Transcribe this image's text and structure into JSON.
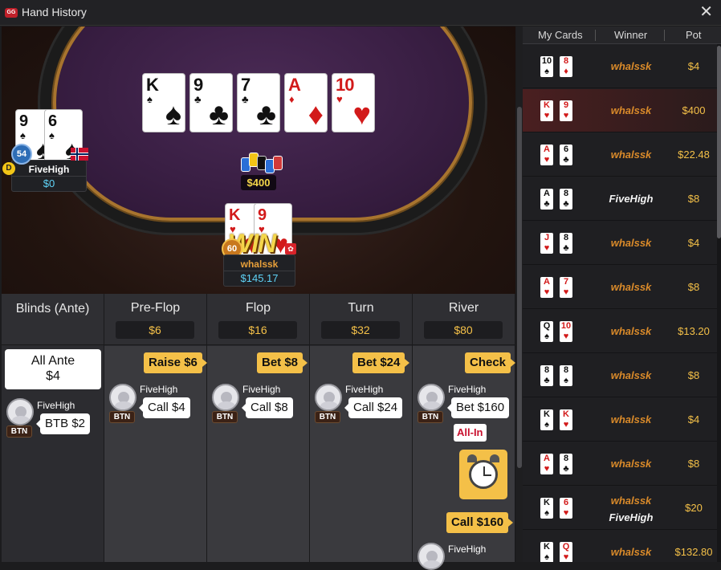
{
  "window": {
    "title": "Hand History",
    "logo": "GG",
    "close_icon": "close-icon"
  },
  "board": {
    "cards": [
      {
        "rank": "K",
        "suit": "♠",
        "red": false
      },
      {
        "rank": "9",
        "suit": "♣",
        "red": false
      },
      {
        "rank": "7",
        "suit": "♣",
        "red": false
      },
      {
        "rank": "A",
        "suit": "♦",
        "red": true
      },
      {
        "rank": "10",
        "suit": "♥",
        "red": true
      }
    ],
    "pot": "$400"
  },
  "seats": {
    "left": {
      "name": "FiveHigh",
      "stack": "$0",
      "level": "54",
      "dealer": "D",
      "cards": [
        {
          "rank": "9",
          "suit": "♠",
          "red": false
        },
        {
          "rank": "6",
          "suit": "♠",
          "red": false
        }
      ]
    },
    "bottom": {
      "name": "whalssk",
      "stack": "$145.17",
      "level": "60",
      "badge": "WIN",
      "cards": [
        {
          "rank": "K",
          "suit": "♥",
          "red": true
        },
        {
          "rank": "9",
          "suit": "♥",
          "red": true
        }
      ]
    }
  },
  "streets": [
    {
      "title": "Blinds (Ante)",
      "amount": ""
    },
    {
      "title": "Pre-Flop",
      "amount": "$6"
    },
    {
      "title": "Flop",
      "amount": "$16"
    },
    {
      "title": "Turn",
      "amount": "$32"
    },
    {
      "title": "River",
      "amount": "$80"
    }
  ],
  "actions": {
    "ante_line1": "All Ante",
    "ante_line2": "$4",
    "blinds_player": "FiveHigh",
    "blinds_action": "BTB $2",
    "btn": "BTN",
    "preflop_tag": "Raise $6",
    "preflop_player": "FiveHigh",
    "preflop_action": "Call $4",
    "flop_tag": "Bet $8",
    "flop_player": "FiveHigh",
    "flop_action": "Call $8",
    "turn_tag": "Bet $24",
    "turn_player": "FiveHigh",
    "turn_action": "Call $24",
    "river_tag": "Check",
    "river_player": "FiveHigh",
    "river_action": "Bet $160",
    "river_allin": "All-In",
    "river_call": "Call $160",
    "river_player2": "FiveHigh"
  },
  "history": {
    "headers": {
      "cards": "My Cards",
      "winner": "Winner",
      "pot": "Pot"
    },
    "rows": [
      {
        "c1": "10",
        "s1": "♠",
        "r1": false,
        "c2": "8",
        "s2": "♦",
        "r2": true,
        "winner": "whalssk",
        "pot": "$4"
      },
      {
        "c1": "K",
        "s1": "♥",
        "r1": true,
        "c2": "9",
        "s2": "♥",
        "r2": true,
        "winner": "whalssk",
        "pot": "$400"
      },
      {
        "c1": "A",
        "s1": "♥",
        "r1": true,
        "c2": "6",
        "s2": "♣",
        "r2": false,
        "winner": "whalssk",
        "pot": "$22.48"
      },
      {
        "c1": "A",
        "s1": "♣",
        "r1": false,
        "c2": "8",
        "s2": "♣",
        "r2": false,
        "winner": "FiveHigh",
        "pot": "$8"
      },
      {
        "c1": "J",
        "s1": "♥",
        "r1": true,
        "c2": "8",
        "s2": "♣",
        "r2": false,
        "winner": "whalssk",
        "pot": "$4"
      },
      {
        "c1": "A",
        "s1": "♥",
        "r1": true,
        "c2": "7",
        "s2": "♥",
        "r2": true,
        "winner": "whalssk",
        "pot": "$8"
      },
      {
        "c1": "Q",
        "s1": "♠",
        "r1": false,
        "c2": "10",
        "s2": "♥",
        "r2": true,
        "winner": "whalssk",
        "pot": "$13.20"
      },
      {
        "c1": "8",
        "s1": "♣",
        "r1": false,
        "c2": "8",
        "s2": "♠",
        "r2": false,
        "winner": "whalssk",
        "pot": "$8"
      },
      {
        "c1": "K",
        "s1": "♠",
        "r1": false,
        "c2": "K",
        "s2": "♥",
        "r2": true,
        "winner": "whalssk",
        "pot": "$4"
      },
      {
        "c1": "A",
        "s1": "♥",
        "r1": true,
        "c2": "8",
        "s2": "♣",
        "r2": false,
        "winner": "whalssk",
        "pot": "$8"
      },
      {
        "c1": "K",
        "s1": "♠",
        "r1": false,
        "c2": "6",
        "s2": "♥",
        "r2": true,
        "winner": "whalssk",
        "winner2": "FiveHigh",
        "pot": "$20"
      },
      {
        "c1": "K",
        "s1": "♠",
        "r1": false,
        "c2": "Q",
        "s2": "♥",
        "r2": true,
        "winner": "whalssk",
        "pot": "$132.80"
      }
    ]
  },
  "colors": {
    "accent": "#f4c048",
    "felt": "#3a1f44",
    "winner": "#d98a2a",
    "stack": "#5fd3f7"
  }
}
